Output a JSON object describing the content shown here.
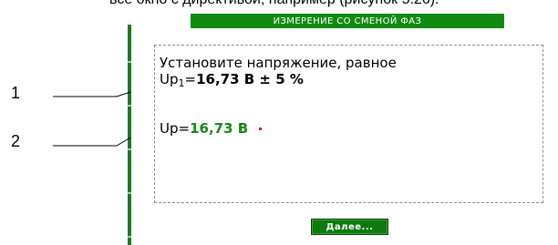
{
  "doc_text": "все окно с директивой, например (рисунок 5.26):",
  "window": {
    "title": "ИЗМЕРЕНИЕ СО СМЕНОЙ ФАЗ"
  },
  "instruction": {
    "line1": "Установите напряжение, равное",
    "setpoint_label": "Up",
    "setpoint_subscript": "1",
    "setpoint_eq": "=",
    "setpoint_value": "16,73 В ± 5 %"
  },
  "measurement": {
    "label": "Up=",
    "value": "16,73 В"
  },
  "next_button": "Далее...",
  "callouts": {
    "one": "1",
    "two": "2"
  },
  "colors": {
    "title_bg": "#118a11",
    "measured_value": "#138a13",
    "indicator_dot": "#e0151c",
    "button_bg": "#0d7a0d"
  }
}
